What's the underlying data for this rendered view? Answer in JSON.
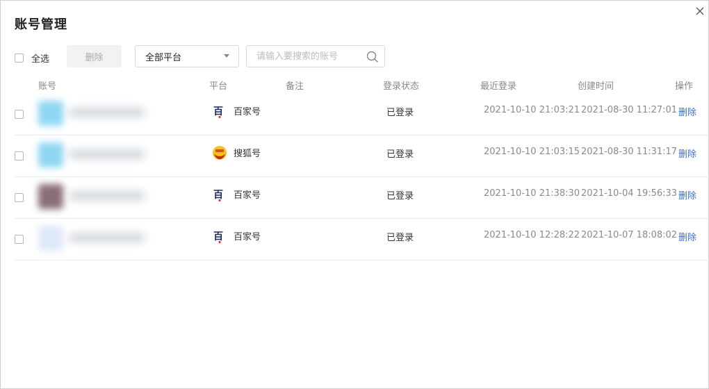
{
  "dialog": {
    "title": "账号管理"
  },
  "toolbar": {
    "select_all_label": "全选",
    "delete_label": "删除",
    "platform_selected": "全部平台",
    "search_placeholder": "请输入要搜索的账号"
  },
  "table": {
    "headers": {
      "account": "账号",
      "platform": "平台",
      "note": "备注",
      "status": "登录状态",
      "last_login": "最近登录",
      "created": "创建时间",
      "action": "操作"
    },
    "rows": [
      {
        "platform": "百家号",
        "platform_icon": "baijiahao-icon",
        "status": "已登录",
        "last_login": "2021-10-10 21:03:21",
        "created": "2021-08-30 11:27:01",
        "action": "删除",
        "avatar_color": "#8fd6f2"
      },
      {
        "platform": "搜狐号",
        "platform_icon": "sohu-icon",
        "status": "已登录",
        "last_login": "2021-10-10 21:03:15",
        "created": "2021-08-30 11:31:17",
        "action": "删除",
        "avatar_color": "#8fd6f2"
      },
      {
        "platform": "百家号",
        "platform_icon": "baijiahao-icon",
        "status": "已登录",
        "last_login": "2021-10-10 21:38:30",
        "created": "2021-10-04 19:56:33",
        "action": "删除",
        "avatar_color": "#8a6e78"
      },
      {
        "platform": "百家号",
        "platform_icon": "baijiahao-icon",
        "status": "已登录",
        "last_login": "2021-10-10 12:28:22",
        "created": "2021-10-07 18:08:02",
        "action": "删除",
        "avatar_color": "#dfe8f7"
      }
    ]
  },
  "colors": {
    "link": "#3b6fe0",
    "muted_text": "#8a8a8a",
    "sohu_yellow": "#f4c21b",
    "sohu_red": "#c8241c"
  }
}
